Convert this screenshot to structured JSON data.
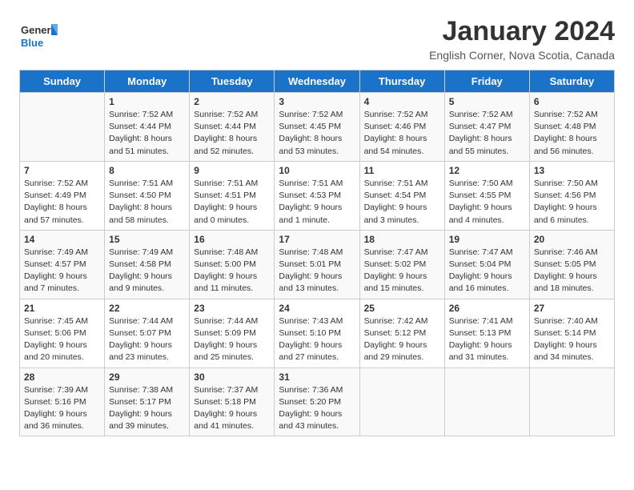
{
  "header": {
    "logo_line1": "General",
    "logo_line2": "Blue",
    "month_title": "January 2024",
    "subtitle": "English Corner, Nova Scotia, Canada"
  },
  "days_of_week": [
    "Sunday",
    "Monday",
    "Tuesday",
    "Wednesday",
    "Thursday",
    "Friday",
    "Saturday"
  ],
  "weeks": [
    [
      {
        "day": "",
        "sunrise": "",
        "sunset": "",
        "daylight": ""
      },
      {
        "day": "1",
        "sunrise": "Sunrise: 7:52 AM",
        "sunset": "Sunset: 4:44 PM",
        "daylight": "Daylight: 8 hours and 51 minutes."
      },
      {
        "day": "2",
        "sunrise": "Sunrise: 7:52 AM",
        "sunset": "Sunset: 4:44 PM",
        "daylight": "Daylight: 8 hours and 52 minutes."
      },
      {
        "day": "3",
        "sunrise": "Sunrise: 7:52 AM",
        "sunset": "Sunset: 4:45 PM",
        "daylight": "Daylight: 8 hours and 53 minutes."
      },
      {
        "day": "4",
        "sunrise": "Sunrise: 7:52 AM",
        "sunset": "Sunset: 4:46 PM",
        "daylight": "Daylight: 8 hours and 54 minutes."
      },
      {
        "day": "5",
        "sunrise": "Sunrise: 7:52 AM",
        "sunset": "Sunset: 4:47 PM",
        "daylight": "Daylight: 8 hours and 55 minutes."
      },
      {
        "day": "6",
        "sunrise": "Sunrise: 7:52 AM",
        "sunset": "Sunset: 4:48 PM",
        "daylight": "Daylight: 8 hours and 56 minutes."
      }
    ],
    [
      {
        "day": "7",
        "sunrise": "Sunrise: 7:52 AM",
        "sunset": "Sunset: 4:49 PM",
        "daylight": "Daylight: 8 hours and 57 minutes."
      },
      {
        "day": "8",
        "sunrise": "Sunrise: 7:51 AM",
        "sunset": "Sunset: 4:50 PM",
        "daylight": "Daylight: 8 hours and 58 minutes."
      },
      {
        "day": "9",
        "sunrise": "Sunrise: 7:51 AM",
        "sunset": "Sunset: 4:51 PM",
        "daylight": "Daylight: 9 hours and 0 minutes."
      },
      {
        "day": "10",
        "sunrise": "Sunrise: 7:51 AM",
        "sunset": "Sunset: 4:53 PM",
        "daylight": "Daylight: 9 hours and 1 minute."
      },
      {
        "day": "11",
        "sunrise": "Sunrise: 7:51 AM",
        "sunset": "Sunset: 4:54 PM",
        "daylight": "Daylight: 9 hours and 3 minutes."
      },
      {
        "day": "12",
        "sunrise": "Sunrise: 7:50 AM",
        "sunset": "Sunset: 4:55 PM",
        "daylight": "Daylight: 9 hours and 4 minutes."
      },
      {
        "day": "13",
        "sunrise": "Sunrise: 7:50 AM",
        "sunset": "Sunset: 4:56 PM",
        "daylight": "Daylight: 9 hours and 6 minutes."
      }
    ],
    [
      {
        "day": "14",
        "sunrise": "Sunrise: 7:49 AM",
        "sunset": "Sunset: 4:57 PM",
        "daylight": "Daylight: 9 hours and 7 minutes."
      },
      {
        "day": "15",
        "sunrise": "Sunrise: 7:49 AM",
        "sunset": "Sunset: 4:58 PM",
        "daylight": "Daylight: 9 hours and 9 minutes."
      },
      {
        "day": "16",
        "sunrise": "Sunrise: 7:48 AM",
        "sunset": "Sunset: 5:00 PM",
        "daylight": "Daylight: 9 hours and 11 minutes."
      },
      {
        "day": "17",
        "sunrise": "Sunrise: 7:48 AM",
        "sunset": "Sunset: 5:01 PM",
        "daylight": "Daylight: 9 hours and 13 minutes."
      },
      {
        "day": "18",
        "sunrise": "Sunrise: 7:47 AM",
        "sunset": "Sunset: 5:02 PM",
        "daylight": "Daylight: 9 hours and 15 minutes."
      },
      {
        "day": "19",
        "sunrise": "Sunrise: 7:47 AM",
        "sunset": "Sunset: 5:04 PM",
        "daylight": "Daylight: 9 hours and 16 minutes."
      },
      {
        "day": "20",
        "sunrise": "Sunrise: 7:46 AM",
        "sunset": "Sunset: 5:05 PM",
        "daylight": "Daylight: 9 hours and 18 minutes."
      }
    ],
    [
      {
        "day": "21",
        "sunrise": "Sunrise: 7:45 AM",
        "sunset": "Sunset: 5:06 PM",
        "daylight": "Daylight: 9 hours and 20 minutes."
      },
      {
        "day": "22",
        "sunrise": "Sunrise: 7:44 AM",
        "sunset": "Sunset: 5:07 PM",
        "daylight": "Daylight: 9 hours and 23 minutes."
      },
      {
        "day": "23",
        "sunrise": "Sunrise: 7:44 AM",
        "sunset": "Sunset: 5:09 PM",
        "daylight": "Daylight: 9 hours and 25 minutes."
      },
      {
        "day": "24",
        "sunrise": "Sunrise: 7:43 AM",
        "sunset": "Sunset: 5:10 PM",
        "daylight": "Daylight: 9 hours and 27 minutes."
      },
      {
        "day": "25",
        "sunrise": "Sunrise: 7:42 AM",
        "sunset": "Sunset: 5:12 PM",
        "daylight": "Daylight: 9 hours and 29 minutes."
      },
      {
        "day": "26",
        "sunrise": "Sunrise: 7:41 AM",
        "sunset": "Sunset: 5:13 PM",
        "daylight": "Daylight: 9 hours and 31 minutes."
      },
      {
        "day": "27",
        "sunrise": "Sunrise: 7:40 AM",
        "sunset": "Sunset: 5:14 PM",
        "daylight": "Daylight: 9 hours and 34 minutes."
      }
    ],
    [
      {
        "day": "28",
        "sunrise": "Sunrise: 7:39 AM",
        "sunset": "Sunset: 5:16 PM",
        "daylight": "Daylight: 9 hours and 36 minutes."
      },
      {
        "day": "29",
        "sunrise": "Sunrise: 7:38 AM",
        "sunset": "Sunset: 5:17 PM",
        "daylight": "Daylight: 9 hours and 39 minutes."
      },
      {
        "day": "30",
        "sunrise": "Sunrise: 7:37 AM",
        "sunset": "Sunset: 5:18 PM",
        "daylight": "Daylight: 9 hours and 41 minutes."
      },
      {
        "day": "31",
        "sunrise": "Sunrise: 7:36 AM",
        "sunset": "Sunset: 5:20 PM",
        "daylight": "Daylight: 9 hours and 43 minutes."
      },
      {
        "day": "",
        "sunrise": "",
        "sunset": "",
        "daylight": ""
      },
      {
        "day": "",
        "sunrise": "",
        "sunset": "",
        "daylight": ""
      },
      {
        "day": "",
        "sunrise": "",
        "sunset": "",
        "daylight": ""
      }
    ]
  ]
}
